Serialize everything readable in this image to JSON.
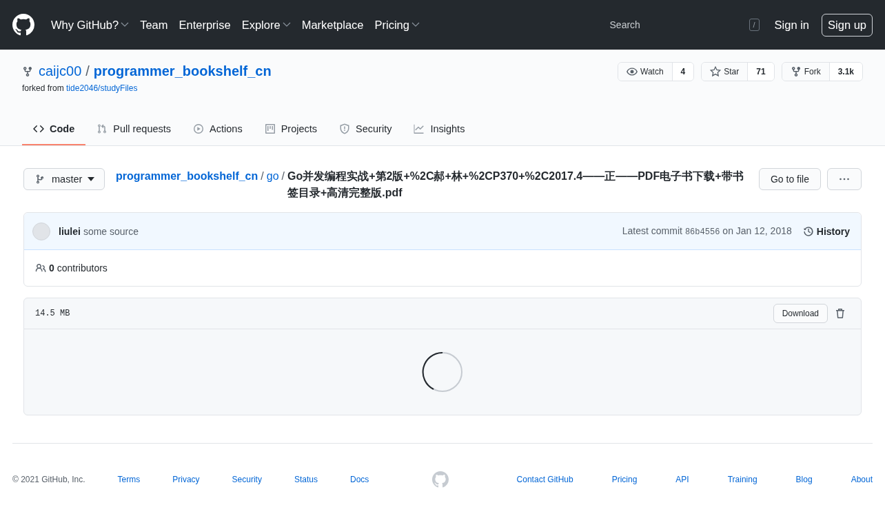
{
  "header": {
    "nav": [
      {
        "label": "Why GitHub?",
        "dropdown": true
      },
      {
        "label": "Team",
        "dropdown": false
      },
      {
        "label": "Enterprise",
        "dropdown": false
      },
      {
        "label": "Explore",
        "dropdown": true
      },
      {
        "label": "Marketplace",
        "dropdown": false
      },
      {
        "label": "Pricing",
        "dropdown": true
      }
    ],
    "search": {
      "placeholder": "Search",
      "key": "/"
    },
    "sign_in": "Sign in",
    "sign_up": "Sign up"
  },
  "repo": {
    "owner": "caijc00",
    "separator": "/",
    "name": "programmer_bookshelf_cn",
    "forked_from_label": "forked from",
    "forked_from": "tide2046/studyFiles",
    "actions": [
      {
        "kind": "watch",
        "label": "Watch",
        "count": "4"
      },
      {
        "kind": "star",
        "label": "Star",
        "count": "71"
      },
      {
        "kind": "fork",
        "label": "Fork",
        "count": "3.1k"
      }
    ]
  },
  "tabs": [
    {
      "kind": "code",
      "label": "Code",
      "selected": true
    },
    {
      "kind": "pulls",
      "label": "Pull requests",
      "selected": false
    },
    {
      "kind": "actions",
      "label": "Actions",
      "selected": false
    },
    {
      "kind": "projects",
      "label": "Projects",
      "selected": false
    },
    {
      "kind": "security",
      "label": "Security",
      "selected": false
    },
    {
      "kind": "insights",
      "label": "Insights",
      "selected": false
    }
  ],
  "file": {
    "branch": "master",
    "breadcrumb": [
      "programmer_bookshelf_cn",
      "go"
    ],
    "separators": [
      "/",
      "/"
    ],
    "filename": "Go并发编程实战+第2版+%2C郝+林+%2CP370+%2C2017.4——正——PDF电子书下载+带书签目录+高清完整版.pdf",
    "go_to_file": "Go to file",
    "commit": {
      "author": "liulei",
      "message": "some source",
      "latest_label": "Latest commit",
      "sha": "86b4556",
      "date": "on Jan 12, 2018",
      "history": "History"
    },
    "contributors": {
      "count": "0",
      "label": "contributors"
    },
    "size": "14.5 MB",
    "download": "Download"
  },
  "footer": {
    "copyright": "© 2021 GitHub, Inc.",
    "left_links": [
      "Terms",
      "Privacy",
      "Security",
      "Status",
      "Docs"
    ],
    "right_links": [
      "Contact GitHub",
      "Pricing",
      "API",
      "Training",
      "Blog",
      "About"
    ]
  }
}
